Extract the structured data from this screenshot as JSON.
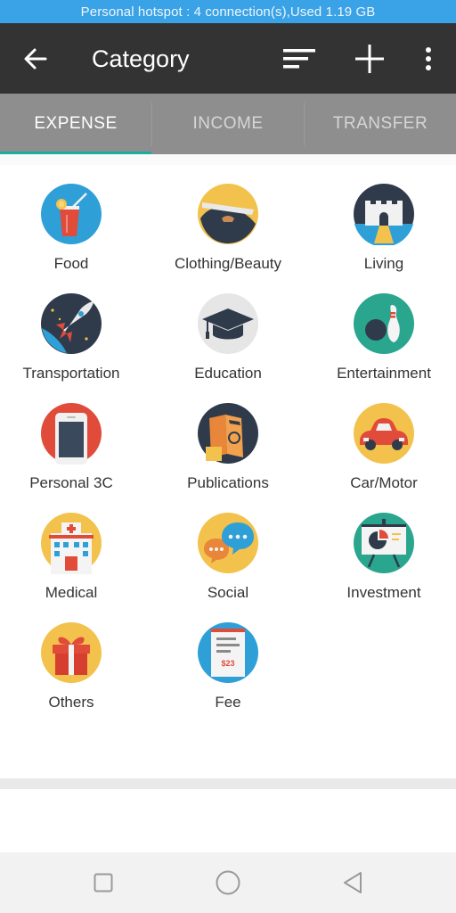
{
  "status_bar": {
    "text": "Personal hotspot : 4 connection(s),Used  1.19 GB"
  },
  "app_bar": {
    "title": "Category"
  },
  "tabs": [
    {
      "label": "EXPENSE",
      "active": true
    },
    {
      "label": "INCOME",
      "active": false
    },
    {
      "label": "TRANSFER",
      "active": false
    }
  ],
  "categories": [
    {
      "label": "Food",
      "icon": "food-icon"
    },
    {
      "label": "Clothing/Beauty",
      "icon": "clothing-beauty-icon"
    },
    {
      "label": "Living",
      "icon": "living-icon"
    },
    {
      "label": "Transportation",
      "icon": "transportation-icon"
    },
    {
      "label": "Education",
      "icon": "education-icon"
    },
    {
      "label": "Entertainment",
      "icon": "entertainment-icon"
    },
    {
      "label": "Personal 3C",
      "icon": "personal-3c-icon"
    },
    {
      "label": "Publications",
      "icon": "publications-icon"
    },
    {
      "label": "Car/Motor",
      "icon": "car-motor-icon"
    },
    {
      "label": "Medical",
      "icon": "medical-icon"
    },
    {
      "label": "Social",
      "icon": "social-icon"
    },
    {
      "label": "Investment",
      "icon": "investment-icon"
    },
    {
      "label": "Others",
      "icon": "others-icon"
    },
    {
      "label": "Fee",
      "icon": "fee-icon",
      "amount": "$23"
    }
  ],
  "colors": {
    "status_bar": "#3aa2e6",
    "app_bar": "#333333",
    "tab_bar": "#8e8e8e",
    "tab_indicator": "#1aaea0"
  }
}
